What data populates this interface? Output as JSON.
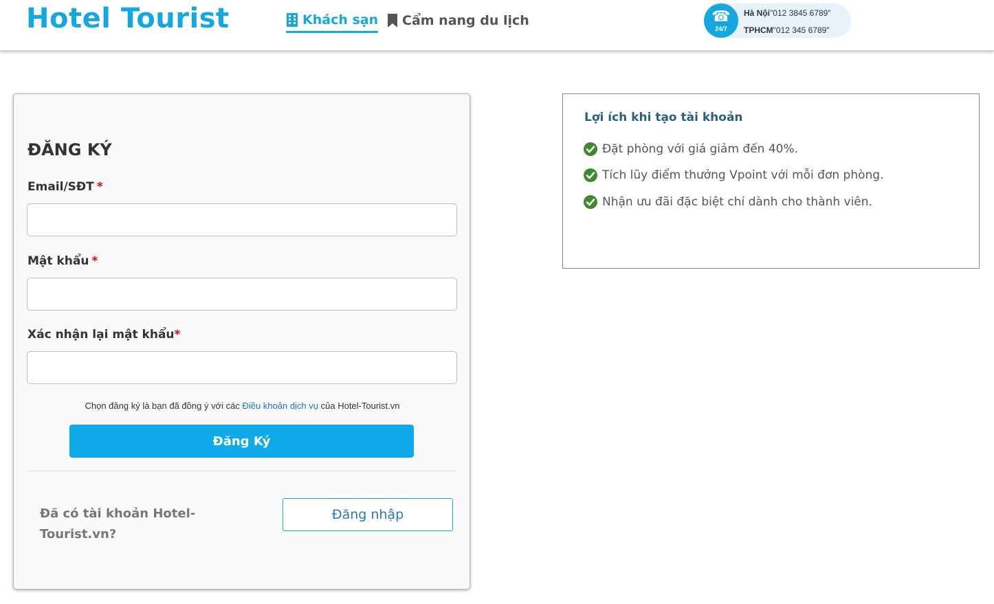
{
  "header": {
    "logo": "Hotel Tourist",
    "nav": [
      {
        "label": "Khách sạn",
        "icon": "building-icon",
        "active": true
      },
      {
        "label": "Cẩm nang du lịch",
        "icon": "bookmark-icon",
        "active": false
      }
    ],
    "hotline": {
      "badge": "24/7",
      "icon": "phone-icon",
      "lines": [
        {
          "city": "Hà Nội",
          "number": "\"012 3845 6789\""
        },
        {
          "city": "TPHCM",
          "number": "\"012 345 6789\""
        }
      ]
    }
  },
  "register": {
    "title": "ĐĂNG KÝ",
    "fields": [
      {
        "label": "Email/SĐT",
        "required": "*",
        "value": "",
        "placeholder": ""
      },
      {
        "label": "Mật khẩu",
        "required": "*",
        "value": "",
        "placeholder": ""
      },
      {
        "label": "Xác nhận lại mật khẩu",
        "required": "*",
        "value": "",
        "placeholder": ""
      }
    ],
    "terms_prefix": "Chọn đăng ký là bạn đã đồng ý với các ",
    "terms_link": "Điều khoản dịch vụ",
    "terms_suffix": " của Hotel-Tourist.vn",
    "submit_label": "Đăng Ký",
    "have_account": "Đã có tài khoản Hotel-Tourist.vn?",
    "login_label": "Đăng nhập"
  },
  "benefits": {
    "title": "Lợi ích khi tạo tài khoản",
    "items": [
      "Đặt phòng với giá giảm đến 40%.",
      "Tích lũy điểm thưởng Vpoint với mỗi đơn phòng.",
      "Nhận ưu đãi đặc biệt chỉ dành cho thành viên."
    ]
  },
  "colors": {
    "brand": "#15a8e0",
    "button": "#0eaae9",
    "check": "#3f8a2e",
    "required": "#e00000"
  }
}
